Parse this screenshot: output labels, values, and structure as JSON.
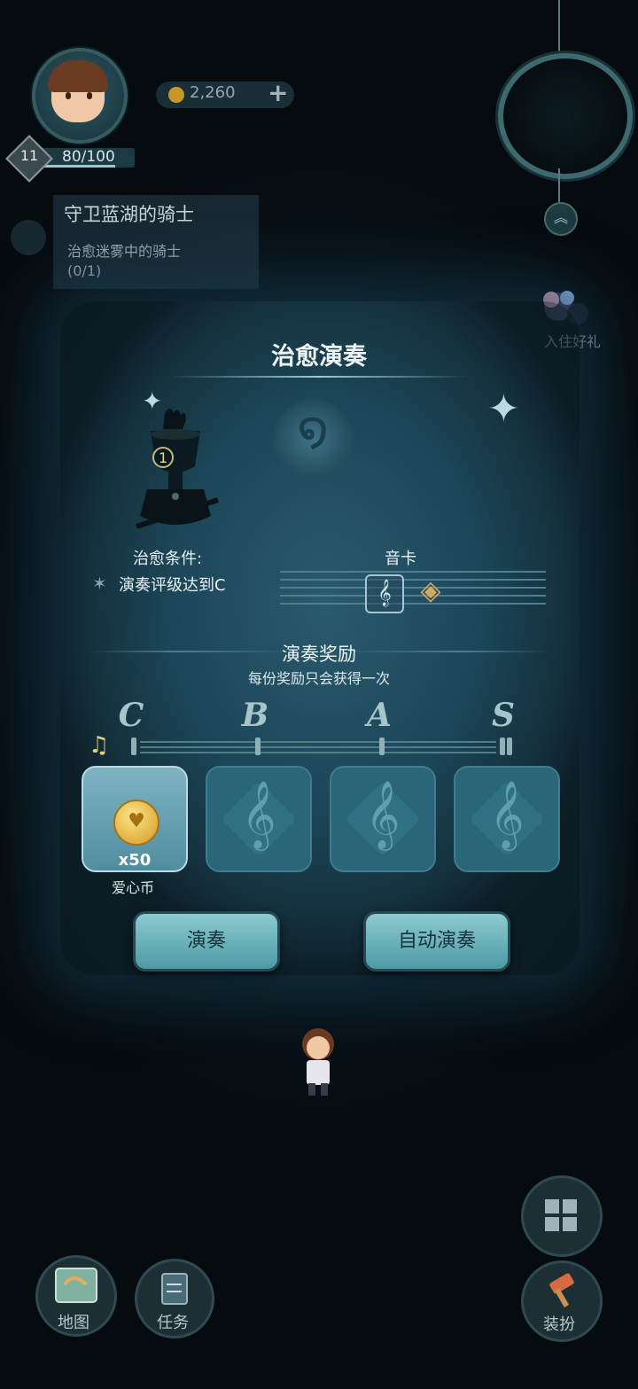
{
  "hud": {
    "level": "11",
    "xp_text": "80/100",
    "xp_progress": 0.8,
    "coins": "2,260",
    "coin_plus": "+"
  },
  "quest": {
    "title": "守卫蓝湖的骑士",
    "subtitle": "治愈迷雾中的骑士",
    "progress": "(0/1)"
  },
  "gift": {
    "label": "入住好礼"
  },
  "modal": {
    "title": "治愈演奏",
    "condition_label": "治愈条件:",
    "condition_value": "演奏评级达到C",
    "card_label": "音卡",
    "reward_title": "演奏奖励",
    "reward_subtitle": "每份奖励只会获得一次",
    "grades": [
      "C",
      "B",
      "A",
      "S"
    ],
    "rewards": [
      {
        "qty": "x50",
        "name": "爱心币",
        "icon": "heart-coin-icon",
        "unlocked": true
      },
      {
        "icon": "treble-clef-icon",
        "unlocked": false
      },
      {
        "icon": "treble-clef-icon",
        "unlocked": false
      },
      {
        "icon": "treble-clef-icon",
        "unlocked": false
      }
    ],
    "play_button": "演奏",
    "auto_play_button": "自动演奏"
  },
  "bottom_nav": {
    "map": "地图",
    "tasks": "任务",
    "dress": "装扮"
  }
}
